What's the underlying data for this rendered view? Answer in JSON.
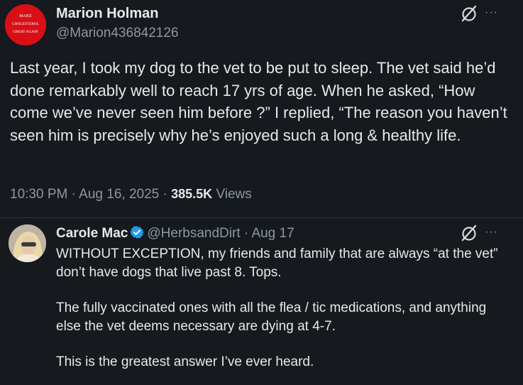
{
  "post": {
    "author_name": "Marion Holman",
    "author_handle": "@Marion436842126",
    "avatar_text": [
      "MAKE",
      "CHOLESTEROL",
      "GREAT AGAIN"
    ],
    "body": "Last year, I took my dog to the vet to be put to sleep. The vet said he’d done remarkably well to reach 17 yrs of age. When he asked, “How come we’ve never seen him before ?” I replied, “The reason you haven’t seen him is precisely why he’s enjoyed such a long & healthy life.",
    "time": "10:30 PM",
    "date": "Aug 16, 2025",
    "views_count": "385.5K",
    "views_label": "Views",
    "separator": "·",
    "more_glyph": "···"
  },
  "reply": {
    "author_name": "Carole Mac",
    "author_handle": "@HerbsandDirt",
    "date": "Aug 17",
    "separator": "·",
    "more_glyph": "···",
    "paragraphs": [
      "WITHOUT EXCEPTION, my friends and family that are always “at the vet” don’t have dogs that live past 8. Tops.",
      "The fully vaccinated ones with all the flea / tic medications, and anything else the vet deems necessary are dying at 4-7.",
      "This is the greatest answer I’ve ever heard."
    ]
  },
  "colors": {
    "background": "#16191d",
    "primary_text": "#e7e9ea",
    "secondary_text": "#8b98a5",
    "verified_blue": "#1d9bf0",
    "avatar_red": "#d80f17"
  },
  "icons": {
    "verified": "verified-badge-icon",
    "grok": "grok-icon",
    "more": "more-icon"
  }
}
